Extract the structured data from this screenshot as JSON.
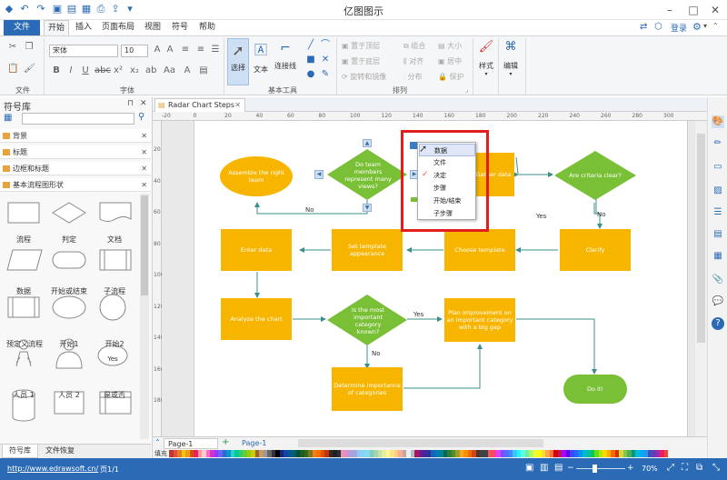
{
  "app": {
    "title": "亿图图示"
  },
  "menu": {
    "file": "文件",
    "tabs": [
      "开始",
      "插入",
      "页面布局",
      "视图",
      "符号",
      "帮助"
    ],
    "login": "登录"
  },
  "ribbon": {
    "groups": [
      "文件",
      "字体",
      "基本工具",
      "排列"
    ],
    "font_name": "宋体",
    "font_size": "10",
    "select": "选择",
    "text": "文本",
    "connector": "连接线",
    "bring_front": "置于顶层",
    "send_back": "置于底层",
    "rotate_mirror": "旋转和镜像",
    "group": "组合",
    "align": "对齐",
    "distribute": "分布",
    "size": "大小",
    "center": "居中",
    "protect": "保护",
    "style": "样式",
    "edit": "编辑"
  },
  "library": {
    "title": "符号库",
    "categories": [
      "背景",
      "标题",
      "边框和标题",
      "基本流程图形状"
    ],
    "shapes": [
      "流程",
      "判定",
      "文档",
      "数据",
      "开始或结束",
      "子流程",
      "预定义流程",
      "开始1",
      "开始2",
      "人员 1",
      "人员 2",
      "是或否"
    ],
    "yes_shape_text": "Yes",
    "bottom_tabs": [
      "符号库",
      "文件恢复"
    ]
  },
  "document": {
    "tab": "Radar Chart Steps"
  },
  "ruler": {
    "h_labels": [
      "-20",
      "0",
      "20",
      "40",
      "60",
      "80",
      "100",
      "120",
      "140",
      "160",
      "180",
      "200",
      "220",
      "240",
      "260",
      "280",
      "300"
    ],
    "v_labels": [
      "20",
      "40",
      "60",
      "80",
      "100",
      "120",
      "140",
      "160",
      "180"
    ]
  },
  "flowchart": {
    "assemble": "Assemble the right team",
    "do_team": "Do team members represent many views?",
    "gather": "Gather data",
    "criteria": "Are criteria clear?",
    "enter": "Enter data",
    "set_template": "Set template appearance",
    "choose": "Choose template",
    "clarify": "Clarify",
    "analyze": "Analyze the chart",
    "most_important": "Is the most important category known?",
    "plan": "Plan improvement on an important category with a big gap",
    "determine": "Determine importance of categories",
    "doit": "Do it!",
    "yes": "Yes",
    "no": "No"
  },
  "context_menu": {
    "items": [
      "数据",
      "文件",
      "决定",
      "步骤",
      "开始/结束",
      "子步骤"
    ]
  },
  "pages": {
    "tab1": "Page-1",
    "current": "Page-1",
    "fill_label": "填充"
  },
  "status": {
    "url": "http://www.edrawsoft.cn/",
    "page": "页1/1",
    "zoom": "70%"
  },
  "palette": [
    "#c0392b",
    "#e74c3c",
    "#e67e22",
    "#f1c40f",
    "#f39c12",
    "#d35400",
    "#e91e63",
    "#ff9999",
    "#ffcccc",
    "#ff66cc",
    "#cc33cc",
    "#9933ff",
    "#6666ff",
    "#3366cc",
    "#0099cc",
    "#33cccc",
    "#00cc99",
    "#33cc66",
    "#66cc33",
    "#99cc00",
    "#cccc00",
    "#996633",
    "#cc9966",
    "#999999",
    "#666666",
    "#333333",
    "#000000",
    "#1a237e",
    "#0d47a1",
    "#01579b",
    "#006064",
    "#004d40",
    "#1b5e20",
    "#33691e",
    "#827717",
    "#f57f17",
    "#ff6f00",
    "#e65100",
    "#bf360c",
    "#3e2723",
    "#212121",
    "#263238",
    "#f48fb1",
    "#ce93d8",
    "#b39ddb",
    "#9fa8da",
    "#90caf9",
    "#81d4fa",
    "#80deea",
    "#80cbc4",
    "#a5d6a7",
    "#c5e1a5",
    "#e6ee9c",
    "#fff59d",
    "#ffe082",
    "#ffcc80",
    "#ffab91",
    "#bcaaa4",
    "#eeeeee",
    "#b0bec5",
    "#ad1457",
    "#6a1b9a",
    "#4527a0",
    "#283593",
    "#1565c0",
    "#0277bd",
    "#00838f",
    "#00695c",
    "#2e7d32",
    "#558b2f",
    "#9e9d24",
    "#f9a825",
    "#ff8f00",
    "#ef6c00",
    "#d84315",
    "#4e342e",
    "#424242",
    "#37474f",
    "#ff5252",
    "#ff4081",
    "#e040fb",
    "#7c4dff",
    "#536dfe",
    "#448aff",
    "#40c4ff",
    "#18ffff",
    "#64ffda",
    "#69f0ae",
    "#b2ff59",
    "#eeff41",
    "#ffff00",
    "#ffd740",
    "#ffab40",
    "#ff6e40",
    "#d50000",
    "#c51162",
    "#aa00ff",
    "#6200ea",
    "#304ffe",
    "#2962ff",
    "#0091ea",
    "#00b8d4",
    "#00bfa5",
    "#00c853",
    "#64dd17",
    "#aeea00",
    "#ffd600",
    "#ffab00",
    "#ff6d00",
    "#dd2c00",
    "#cddc39",
    "#8bc34a",
    "#4caf50",
    "#009688",
    "#00bcd4",
    "#03a9f4",
    "#2196f3",
    "#3f51b5",
    "#673ab7",
    "#9c27b0",
    "#e91e63",
    "#f44336"
  ],
  "colors": {
    "accent": "#2b6bb5",
    "node_orange": "#f7b500",
    "node_green": "#7ac036",
    "highlight_red": "#e01e1e",
    "connector": "#3a8f8a"
  }
}
